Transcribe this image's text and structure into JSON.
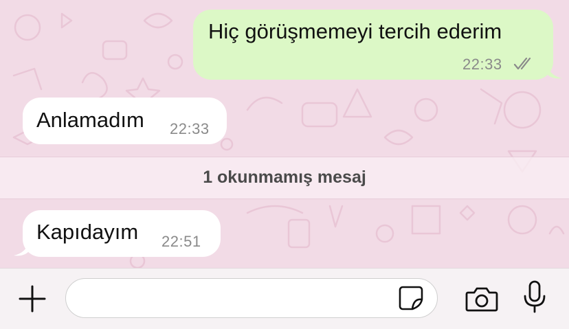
{
  "messages": [
    {
      "text": "Hiç görüşmemeyi tercih ederim",
      "time": "22:33",
      "direction": "outgoing",
      "status": "read"
    },
    {
      "text": "Anlamadım",
      "time": "22:33",
      "direction": "incoming"
    },
    {
      "text": "Kapıdayım",
      "time": "22:51",
      "direction": "incoming"
    }
  ],
  "unread_banner": "1 okunmamış mesaj",
  "input": {
    "value": "",
    "placeholder": ""
  },
  "icons": {
    "attach": "plus-icon",
    "sticker": "sticker-icon",
    "camera": "camera-icon",
    "voice": "microphone-icon",
    "read_receipt": "double-check-icon"
  },
  "colors": {
    "wallpaper": "#f2dbe6",
    "outgoing_bubble": "#dcf8c6",
    "incoming_bubble": "#ffffff",
    "read_receipt": "#8a8a8a"
  }
}
